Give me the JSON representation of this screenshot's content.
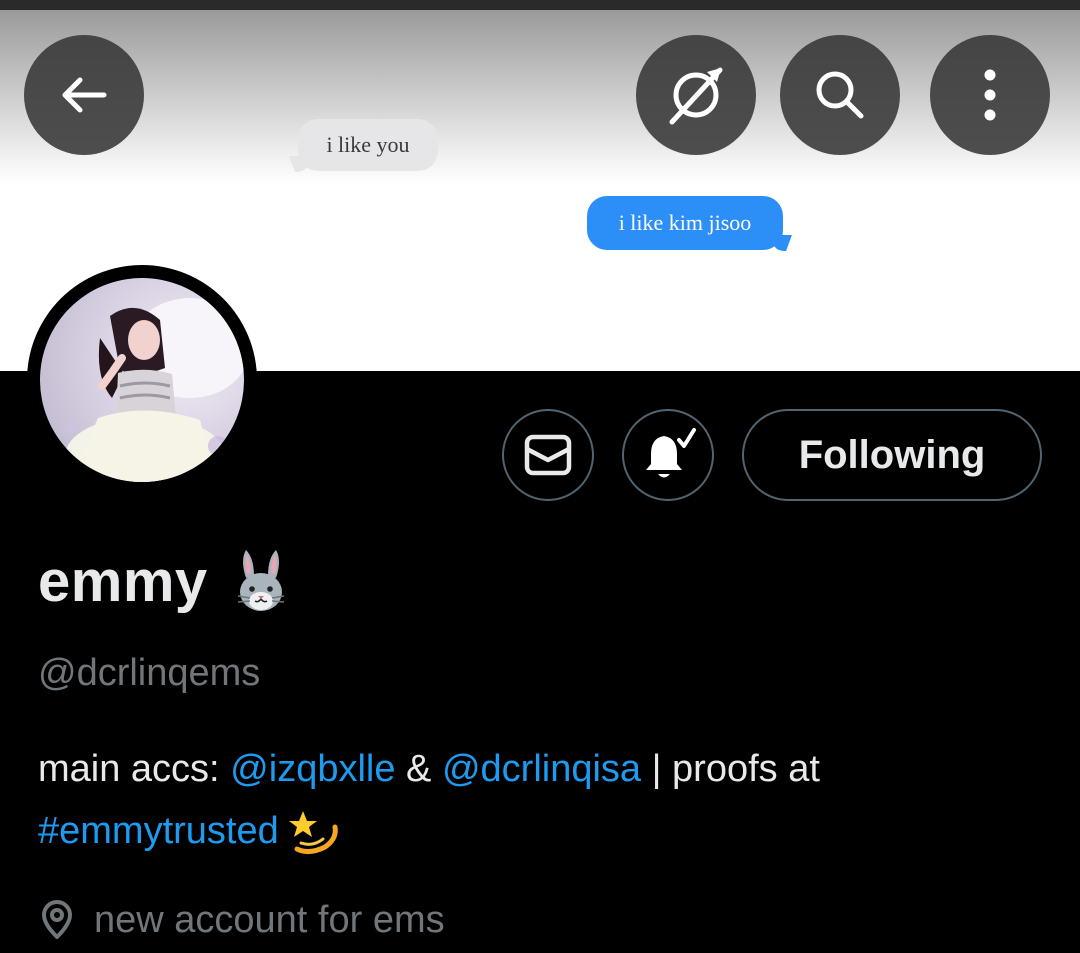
{
  "banner": {
    "bubble_left": "i like you",
    "bubble_right": "i like kim jisoo"
  },
  "toolbar": {
    "back_icon": "arrow-left-icon",
    "translate_icon": "translate-slash-icon",
    "search_icon": "search-icon",
    "more_icon": "more-vertical-icon"
  },
  "profile": {
    "name": "emmy",
    "name_emoji": "rabbit-face-emoji",
    "handle": "@dcrlinqems",
    "bio": {
      "part1": "main accs: ",
      "mention1": "@izqbxlle",
      "amp": " & ",
      "mention2": "@dcrlinqisa",
      "part2": " | proofs at ",
      "hashtag": "#emmytrusted",
      "emoji": "dizzy-emoji"
    },
    "location": "new account for ems"
  },
  "actions": {
    "message_icon": "envelope-icon",
    "notify_icon": "bell-check-icon",
    "follow_label": "Following"
  },
  "colors": {
    "background": "#000000",
    "text_primary": "#e7e9ea",
    "text_secondary": "#71767b",
    "link": "#1d9bf0",
    "border": "#536471",
    "imessage_blue": "#2b8ff7"
  }
}
